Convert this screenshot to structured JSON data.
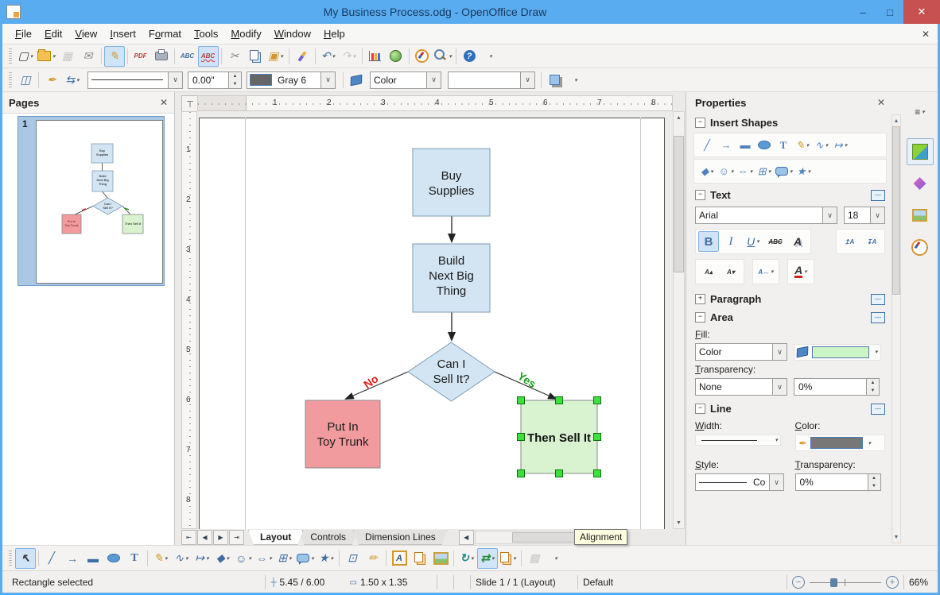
{
  "window": {
    "title": "My Business Process.odg - OpenOffice Draw",
    "minimize_glyph": "–",
    "maximize_glyph": "□",
    "close_glyph": "✕"
  },
  "menu": {
    "close_glyph": "✕",
    "items": [
      {
        "pre": "",
        "u": "F",
        "post": "ile"
      },
      {
        "pre": "",
        "u": "E",
        "post": "dit"
      },
      {
        "pre": "",
        "u": "V",
        "post": "iew"
      },
      {
        "pre": "",
        "u": "I",
        "post": "nsert"
      },
      {
        "pre": "F",
        "u": "o",
        "post": "rmat"
      },
      {
        "pre": "",
        "u": "T",
        "post": "ools"
      },
      {
        "pre": "",
        "u": "M",
        "post": "odify"
      },
      {
        "pre": "",
        "u": "W",
        "post": "indow"
      },
      {
        "pre": "",
        "u": "H",
        "post": "elp"
      }
    ]
  },
  "icons": {
    "new": "▢",
    "save": "▦",
    "email": "✉",
    "edit_mode": "✎",
    "pdf": "PDF",
    "spellcheck": "ABC",
    "autospell": "ABC",
    "cut": "✂",
    "paste": "▣",
    "undo": "↶",
    "redo": "↷",
    "help": "?",
    "styles": "◫",
    "pen": "✒",
    "arrow_style": "⇆",
    "select": "↖",
    "line": "╱",
    "arrow": "→",
    "rect": "▬",
    "text": "T",
    "freeform": "✎",
    "connector": "∿",
    "lines_arrows": "↦",
    "basic_shapes": "◆",
    "symbol_shapes": "☺",
    "block_arrows": "⇔",
    "flowchart": "⊞",
    "stars": "★",
    "edit_points": "⊡",
    "glue_points": "✏",
    "fontwork": "A",
    "rotate": "↻",
    "alignment": "⇄",
    "extrusion": "▩",
    "bold": "B",
    "italic": "I",
    "underline": "U",
    "strike": "ABC",
    "font_shadow": "A",
    "inc_spacing": "↥A",
    "dec_spacing": "↧A",
    "inc_font": "A▴",
    "dec_font": "A▾",
    "char_spacing": "A↔",
    "font_color": "A",
    "sidebar_menu": "≡",
    "nav_first": "⇤",
    "nav_prev": "◀",
    "nav_next": "▶",
    "nav_last": "⇥",
    "position": "┼",
    "size": "▭",
    "zoom_out": "−",
    "zoom_in": "+",
    "collapse": "−",
    "expand": "+",
    "dialog_launcher": "⋯"
  },
  "toolbar_line": {
    "width_value": "0.00\"",
    "line_color_name": "Gray 6",
    "fill_type": "Color"
  },
  "pages_panel": {
    "title": "Pages",
    "close_glyph": "✕",
    "page_number": "1"
  },
  "canvas": {
    "ruler_numbers": [
      "1",
      "2",
      "3",
      "4",
      "5",
      "6",
      "7",
      "8"
    ],
    "tabs": [
      {
        "label": "Layout"
      },
      {
        "label": "Controls"
      },
      {
        "label": "Dimension Lines"
      }
    ],
    "tooltip": "Alignment"
  },
  "flowchart": {
    "buy_lines": [
      "Buy",
      "Supplies"
    ],
    "build_lines": [
      "Build",
      "Next Big",
      "Thing"
    ],
    "decision_lines": [
      "Can I",
      "Sell It?"
    ],
    "no_branch_lines": [
      "Put In",
      "Toy Trunk"
    ],
    "yes_branch_label": "Then Sell It",
    "no_label": "No",
    "yes_label": "Yes"
  },
  "sidebar": {
    "title": "Properties",
    "close_glyph": "✕",
    "insert_shapes_title": "Insert Shapes",
    "text_title": "Text",
    "paragraph_title": "Paragraph",
    "area_title": "Area",
    "line_title": "Line",
    "font_name": "Arial",
    "font_size": "18",
    "fill_label_pre": "F",
    "fill_label_post": "ill:",
    "fill_type": "Color",
    "transparency_label_pre": "T",
    "transparency_label_post": "ransparency:",
    "transparency_type": "None",
    "transparency_value": "0%",
    "width_label_pre": "W",
    "width_label_post": "idth:",
    "color_label_pre": "C",
    "color_label_post": "olor:",
    "style_label_pre": "S",
    "style_label_post": "tyle:",
    "style_value": "Co",
    "line_transparency_label_pre": "T",
    "line_transparency_label_post": "ransparency:",
    "line_transparency_value": "0%"
  },
  "statusbar": {
    "selection": "Rectangle selected",
    "position": "5.45 / 6.00",
    "size": "1.50 x 1.35",
    "slide": "Slide 1 / 1 (Layout)",
    "style_name": "Default",
    "zoom_level": "66%"
  },
  "colors": {
    "titlebar": "#5aacf0",
    "close_button": "#c75050",
    "shape_blue": "#d3e5f2",
    "shape_pink": "#f29b9f",
    "shape_green": "#d9f3d0",
    "selection_handle": "#3fdf3f",
    "no_red": "#dd2222",
    "yes_green": "#1f9c1f",
    "active_highlight": "#cfe3f7"
  }
}
